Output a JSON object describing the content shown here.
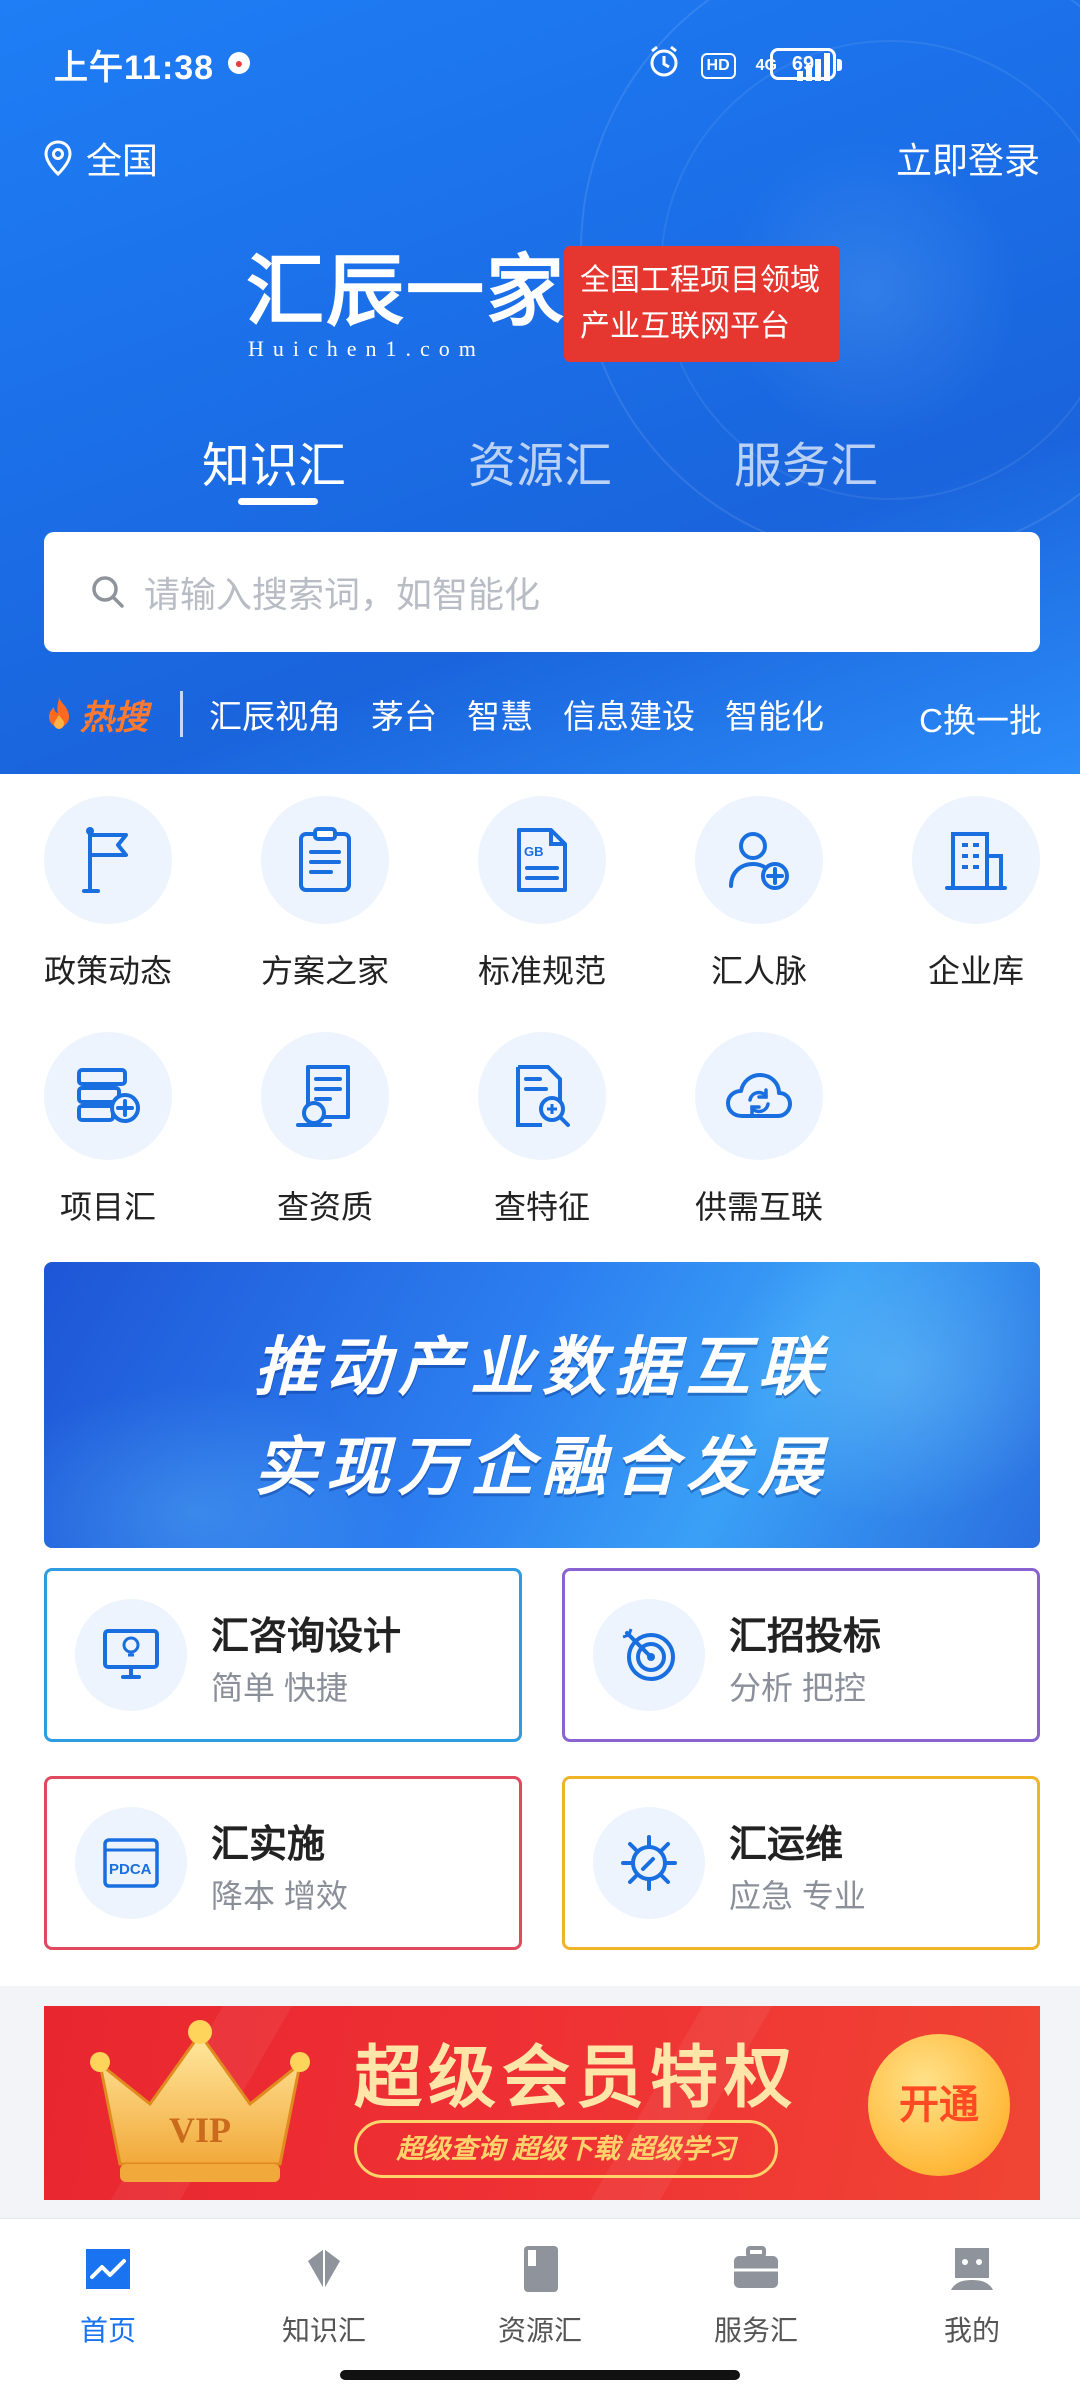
{
  "status_bar": {
    "time": "上午11:38",
    "hd": "HD",
    "network": "4G",
    "battery": "69"
  },
  "header": {
    "location": "全国",
    "login": "立即登录"
  },
  "brand": {
    "name_cn": "汇辰一家",
    "name_en": "Huichen1.com",
    "slogan_line1": "全国工程项目领域",
    "slogan_line2": "产业互联网平台"
  },
  "top_tabs": [
    {
      "label": "知识汇",
      "active": true
    },
    {
      "label": "资源汇",
      "active": false
    },
    {
      "label": "服务汇",
      "active": false
    }
  ],
  "search": {
    "placeholder": "请输入搜索词，如智能化"
  },
  "hot": {
    "label": "热搜",
    "items": [
      "汇辰视角",
      "茅台",
      "智慧",
      "信息建设",
      "智能化"
    ],
    "refresh": "换一批"
  },
  "grid": [
    {
      "label": "政策动态",
      "icon": "flag-icon"
    },
    {
      "label": "方案之家",
      "icon": "clipboard-icon"
    },
    {
      "label": "标准规范",
      "icon": "gb-document-icon"
    },
    {
      "label": "汇人脉",
      "icon": "add-user-icon"
    },
    {
      "label": "企业库",
      "icon": "building-icon"
    },
    {
      "label": "项目汇",
      "icon": "server-add-icon"
    },
    {
      "label": "查资质",
      "icon": "certificate-search-icon"
    },
    {
      "label": "查特征",
      "icon": "document-search-icon"
    },
    {
      "label": "供需互联",
      "icon": "cloud-sync-icon"
    }
  ],
  "banner": {
    "line1": "推动产业数据互联",
    "line2": "实现万企融合发展"
  },
  "services": [
    {
      "title": "汇咨询设计",
      "subtitle": "简单 快捷",
      "icon": "monitor-idea-icon",
      "color": "#2f9be0"
    },
    {
      "title": "汇招投标",
      "subtitle": "分析 把控",
      "icon": "target-icon",
      "color": "#8a63d2"
    },
    {
      "title": "汇实施",
      "subtitle": "降本 增效",
      "icon": "pdca-icon",
      "color": "#e04a5f"
    },
    {
      "title": "汇运维",
      "subtitle": "应急 专业",
      "icon": "gear-wrench-icon",
      "color": "#f0b429"
    }
  ],
  "vip": {
    "crown_text": "VIP",
    "title": "超级会员特权",
    "subtitle": "超级查询 超级下载 超级学习",
    "button": "开通"
  },
  "bottom_nav": [
    {
      "label": "首页",
      "icon": "home-chart-icon",
      "active": true
    },
    {
      "label": "知识汇",
      "icon": "diamond-icon",
      "active": false
    },
    {
      "label": "资源汇",
      "icon": "book-icon",
      "active": false
    },
    {
      "label": "服务汇",
      "icon": "briefcase-icon",
      "active": false
    },
    {
      "label": "我的",
      "icon": "profile-icon",
      "active": false
    }
  ]
}
